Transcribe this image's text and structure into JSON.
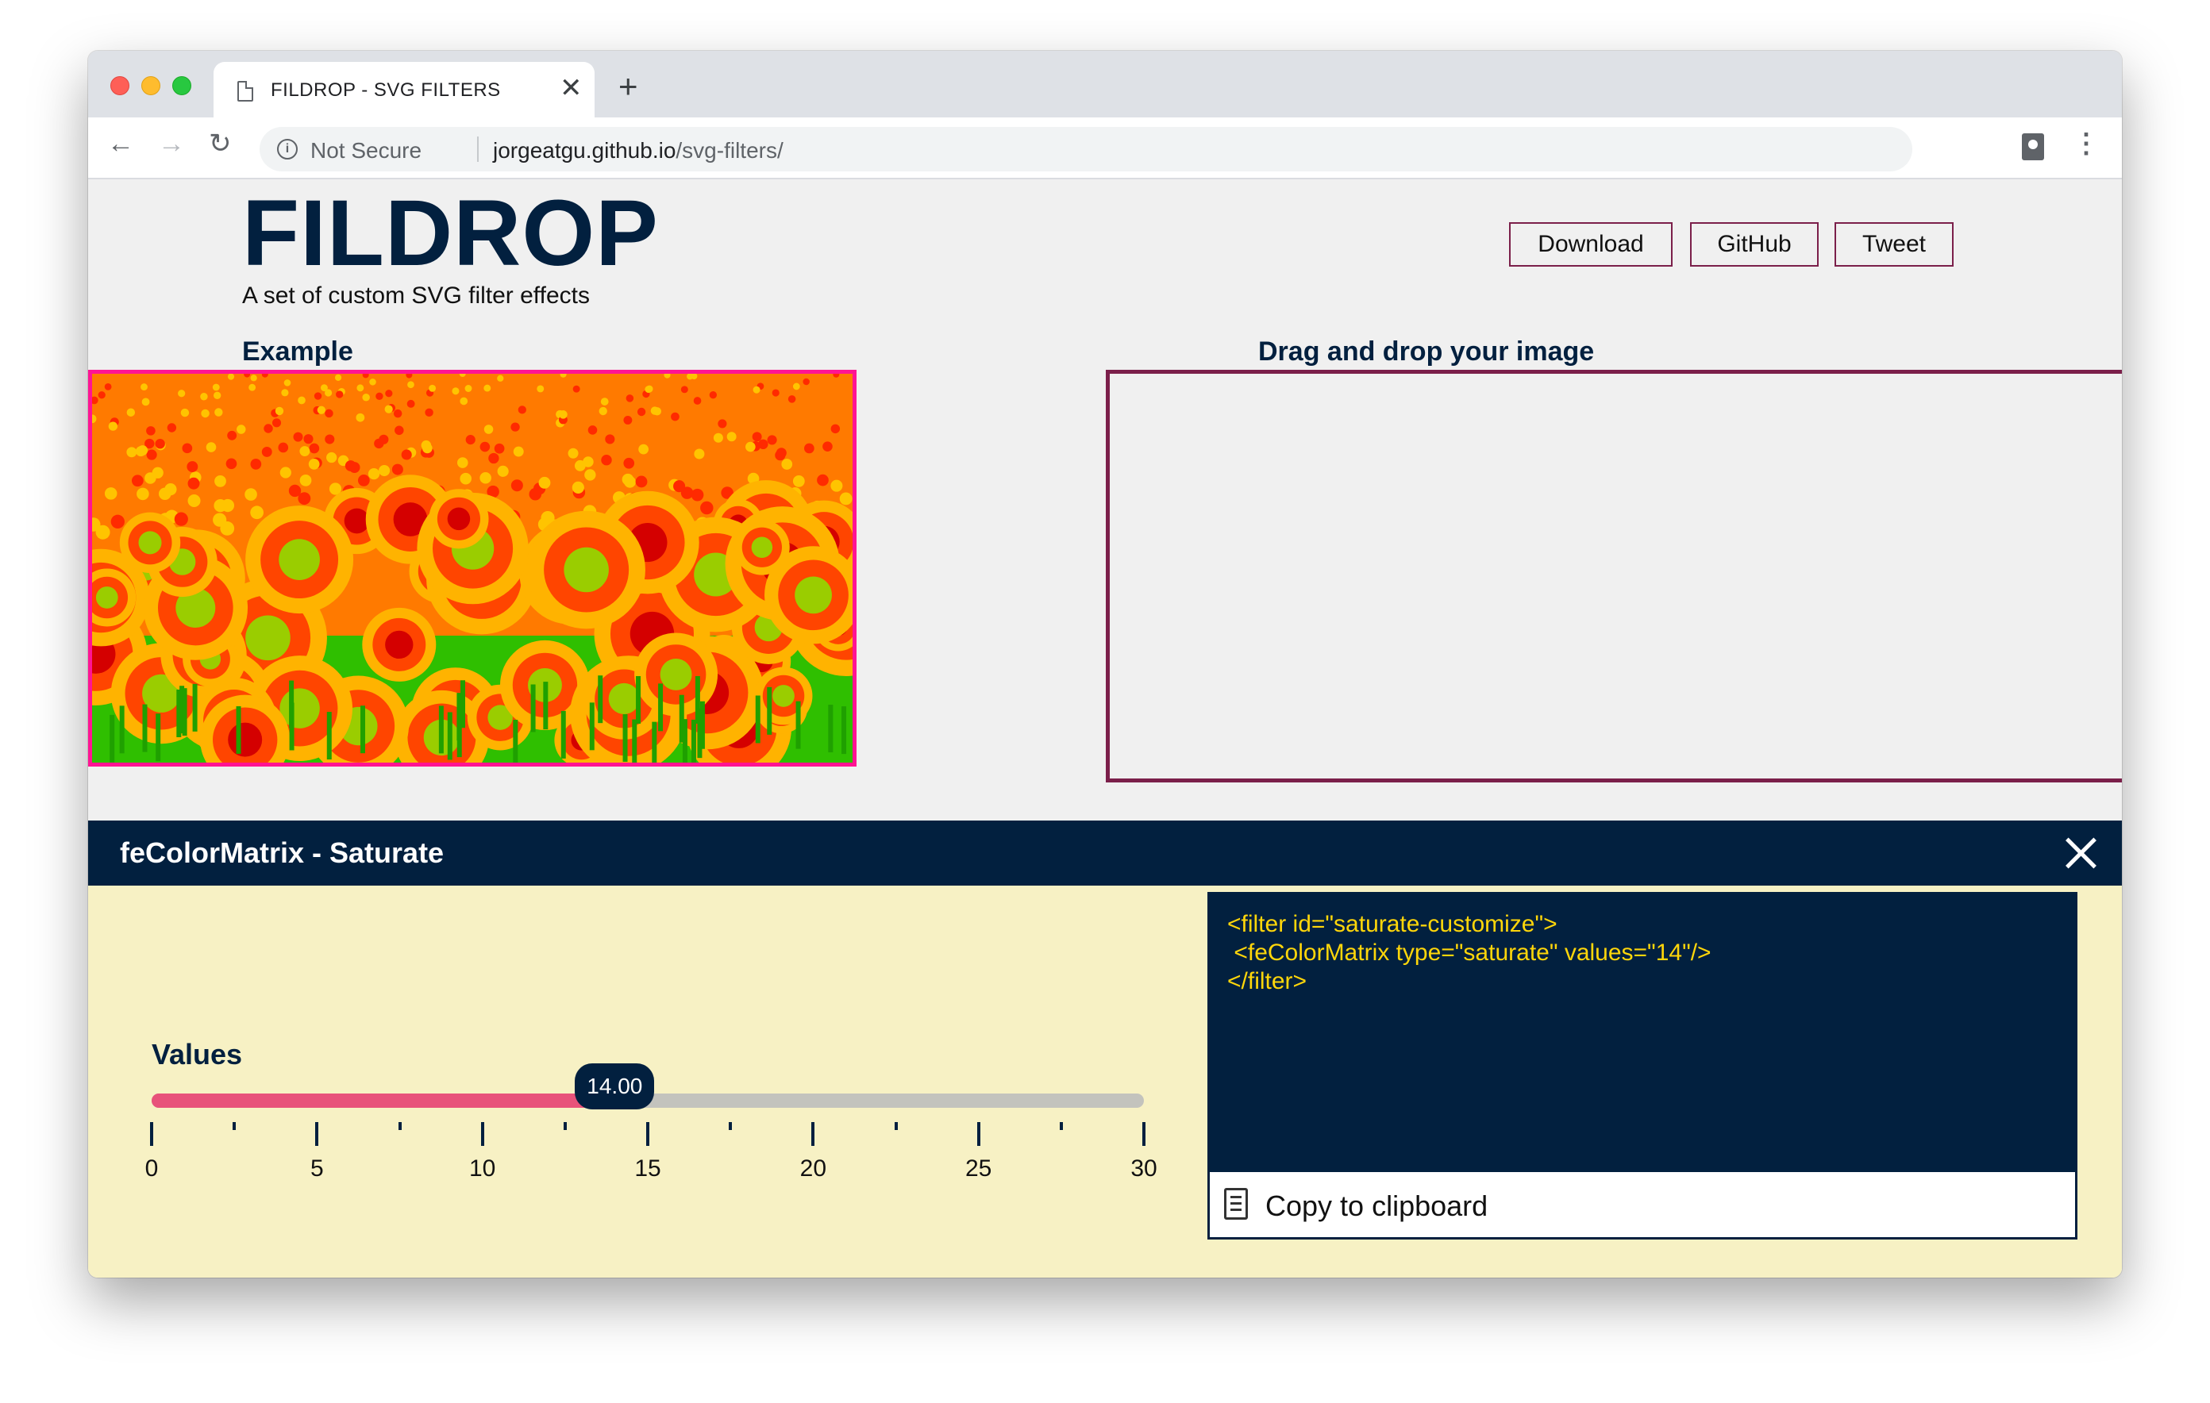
{
  "browser": {
    "tab_title": "FILDROP - SVG FILTERS",
    "tab_close": "✕",
    "new_tab": "+",
    "back": "←",
    "forward": "→",
    "reload": "↻",
    "info_glyph": "i",
    "security_label": "Not Secure",
    "url_host": "jorgeatgu.github.io",
    "url_path": "/svg-filters/",
    "menu": "⋮"
  },
  "header": {
    "logo": "FILDROP",
    "tagline": "A set of custom SVG filter effects",
    "buttons": {
      "download": "Download",
      "github": "GitHub",
      "tweet": "Tweet"
    }
  },
  "sections": {
    "example_title": "Example",
    "drop_title": "Drag and drop your image"
  },
  "filter_panel": {
    "title": "feColorMatrix - Saturate",
    "values_label": "Values",
    "slider": {
      "min": 0,
      "max": 30,
      "value": 14,
      "display": "14.00",
      "tick_labels": [
        "0",
        "5",
        "10",
        "15",
        "20",
        "25",
        "30"
      ]
    },
    "code_lines": [
      "<filter id=\"saturate-customize\">",
      " <feColorMatrix type=\"saturate\" values=\"14\"/>",
      "</filter>"
    ],
    "copy_label": "Copy to clipboard"
  },
  "colors": {
    "brand_navy": "#02203f",
    "slider_fill": "#e8527a",
    "panel_bg": "#f7f1c4",
    "code_text": "#ffd60a",
    "example_border": "#ff1493",
    "drop_border": "#7b1f4a"
  },
  "icons": [
    "page-icon",
    "info-icon",
    "profile-icon",
    "menu-icon",
    "close-icon",
    "clipboard-icon"
  ]
}
